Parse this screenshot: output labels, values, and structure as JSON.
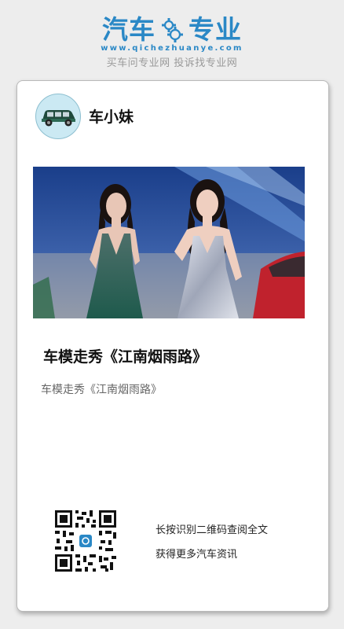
{
  "brand": {
    "logo_left": "汽车",
    "logo_right": "专业",
    "url": "www.qichezhuanye.com",
    "slogan": "买车问专业网 投诉找专业网",
    "accent": "#2a88c6"
  },
  "author": {
    "name": "车小妹",
    "avatar_icon": "car-icon"
  },
  "article": {
    "photo_icon": "car-show-models-photo",
    "title": "车模走秀《江南烟雨路》",
    "subtitle": "车模走秀《江南烟雨路》"
  },
  "footer": {
    "qr_icon": "qr-code-icon",
    "line1": "长按识别二维码查阅全文",
    "line2": "获得更多汽车资讯"
  }
}
